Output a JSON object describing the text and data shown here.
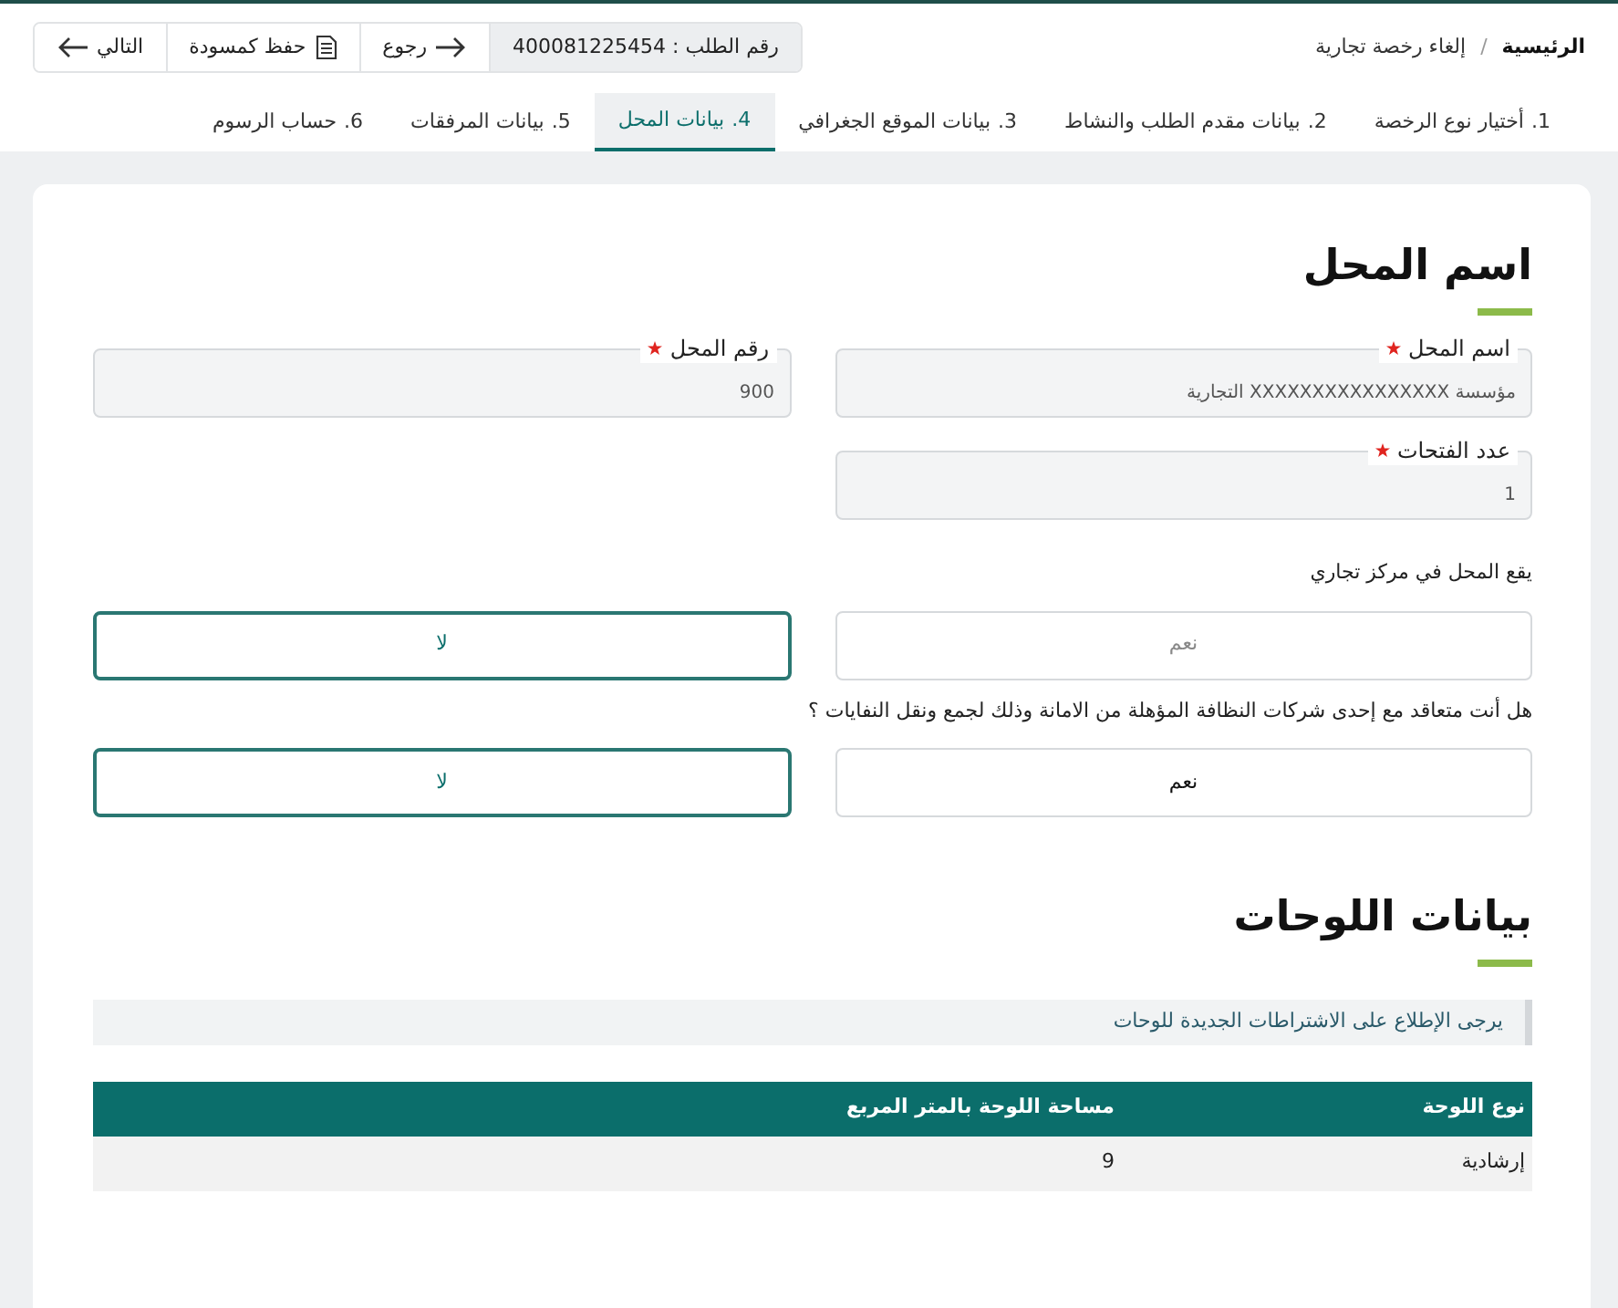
{
  "breadcrumb": [
    {
      "label": "الرئيسية",
      "current": false
    },
    {
      "label": "إلغاء رخصة تجارية",
      "current": true
    }
  ],
  "breadcrumb_separator": "/",
  "toolbar": {
    "request_number": "رقم الطلب : 400081225454",
    "buttons": [
      {
        "kind": "back",
        "label": "رجوع"
      },
      {
        "kind": "draft",
        "label": "حفظ كمسودة"
      },
      {
        "kind": "next",
        "label": "التالي"
      }
    ]
  },
  "tabs": [
    {
      "number": "1.",
      "label": "أختيار نوع الرخصة",
      "selected": false
    },
    {
      "number": "2.",
      "label": "بيانات مقدم الطلب والنشاط",
      "selected": false
    },
    {
      "number": "3.",
      "label": "بيانات الموقع الجغرافي",
      "selected": false
    },
    {
      "number": "4.",
      "label": "بيانات المحل",
      "selected": true
    },
    {
      "number": "5.",
      "label": "بيانات المرفقات",
      "selected": false
    },
    {
      "number": "6.",
      "label": "حساب الرسوم",
      "selected": false
    }
  ],
  "shop_section": {
    "title": "اسم المحل",
    "fields": [
      {
        "label": "اسم المحل",
        "required": true,
        "value": "مؤسسة XXXXXXXXXXXXXXXX التجارية"
      },
      {
        "label": "رقم المحل",
        "required": true,
        "value": "900"
      },
      {
        "label": "عدد الفتحات",
        "required": true,
        "value": "1"
      }
    ],
    "questions": [
      {
        "text": "يقع المحل في مركز تجاري",
        "options": [
          {
            "label": "نعم",
            "selected": false,
            "muted": true
          },
          {
            "label": "لا",
            "selected": true,
            "muted": false
          }
        ]
      },
      {
        "text": "هل أنت متعاقد مع إحدى شركات النظافة المؤهلة من الامانة وذلك لجمع ونقل النفايات ؟",
        "options": [
          {
            "label": "نعم",
            "selected": false,
            "muted": false
          },
          {
            "label": "لا",
            "selected": true,
            "muted": false
          }
        ]
      }
    ]
  },
  "signs_section": {
    "title": "بيانات اللوحات",
    "note": "يرجى الإطلاع على الاشتراطات الجديدة للوحات",
    "table": {
      "columns": [
        "نوع اللوحة",
        "مساحة اللوحة بالمتر المربع"
      ],
      "rows": [
        [
          "إرشادية",
          "9"
        ]
      ]
    }
  }
}
